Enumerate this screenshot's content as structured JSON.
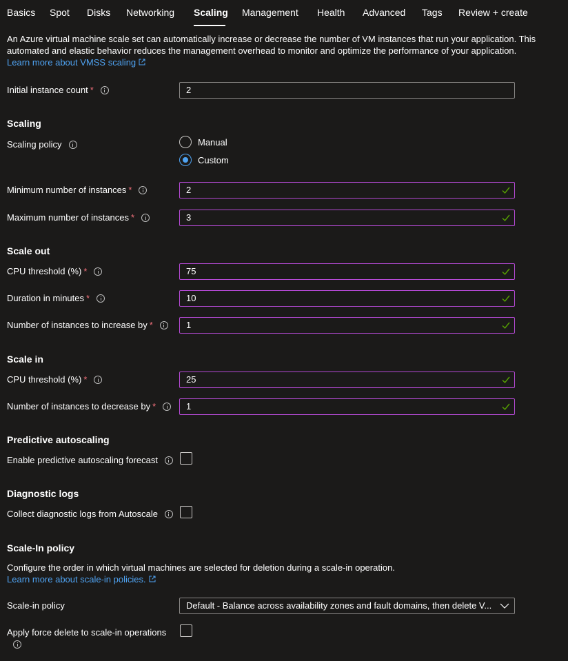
{
  "tabs": [
    {
      "label": "Basics"
    },
    {
      "label": "Spot"
    },
    {
      "label": "Disks"
    },
    {
      "label": "Networking"
    },
    {
      "label": "Scaling"
    },
    {
      "label": "Management"
    },
    {
      "label": "Health"
    },
    {
      "label": "Advanced"
    },
    {
      "label": "Tags"
    },
    {
      "label": "Review + create"
    }
  ],
  "intro": {
    "text": "An Azure virtual machine scale set can automatically increase or decrease the number of VM instances that run your application. This automated and elastic behavior reduces the management overhead to monitor and optimize the performance of your application.",
    "link": "Learn more about VMSS scaling"
  },
  "initial_count": {
    "label": "Initial instance count",
    "required": "*",
    "value": "2"
  },
  "scaling": {
    "heading": "Scaling",
    "policy_label": "Scaling policy",
    "options": [
      "Manual",
      "Custom"
    ],
    "selected": "Custom",
    "min_label": "Minimum number of instances",
    "min_value": "2",
    "max_label": "Maximum number of instances",
    "max_value": "3"
  },
  "scale_out": {
    "heading": "Scale out",
    "cpu_label": "CPU threshold (%)",
    "cpu_value": "75",
    "duration_label": "Duration in minutes",
    "duration_value": "10",
    "increase_label": "Number of instances to increase by",
    "increase_value": "1"
  },
  "scale_in": {
    "heading": "Scale in",
    "cpu_label": "CPU threshold (%)",
    "cpu_value": "25",
    "decrease_label": "Number of instances to decrease by",
    "decrease_value": "1"
  },
  "predictive": {
    "heading": "Predictive autoscaling",
    "label": "Enable predictive autoscaling forecast",
    "checked": false
  },
  "diagnostic": {
    "heading": "Diagnostic logs",
    "label": "Collect diagnostic logs from Autoscale",
    "checked": false
  },
  "scale_in_policy": {
    "heading": "Scale-In policy",
    "description": "Configure the order in which virtual machines are selected for deletion during a scale-in operation.",
    "link": "Learn more about scale-in policies.",
    "policy_label": "Scale-in policy",
    "policy_value": "Default - Balance across availability zones and fault domains, then delete V...",
    "force_label": "Apply force delete to scale-in operations",
    "force_checked": false
  },
  "colors": {
    "background": "#1b1a19",
    "link": "#4fa3f2",
    "required": "#f1707b",
    "valid_border": "#b64ad6",
    "valid_check": "#57a300"
  }
}
